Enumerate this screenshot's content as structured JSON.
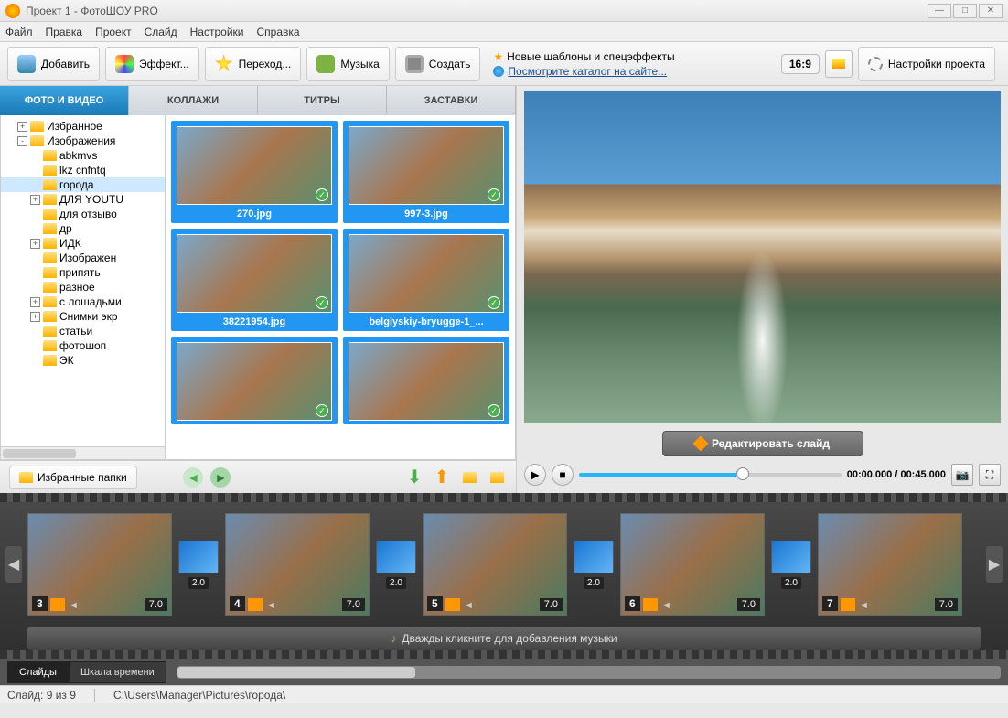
{
  "window": {
    "title": "Проект 1 - ФотоШОУ PRO"
  },
  "menu": [
    "Файл",
    "Правка",
    "Проект",
    "Слайд",
    "Настройки",
    "Справка"
  ],
  "toolbar": {
    "add": "Добавить",
    "fx": "Эффект...",
    "trans": "Переход...",
    "music": "Музыка",
    "create": "Создать",
    "info1": "Новые шаблоны и спецэффекты",
    "info2": "Посмотрите каталог на сайте...",
    "aspect": "16:9",
    "settings": "Настройки проекта"
  },
  "tabs": [
    "ФОТО И ВИДЕО",
    "КОЛЛАЖИ",
    "ТИТРЫ",
    "ЗАСТАВКИ"
  ],
  "tree": [
    {
      "exp": "+",
      "ind": 1,
      "label": "Избранное"
    },
    {
      "exp": "-",
      "ind": 1,
      "label": "Изображения"
    },
    {
      "exp": "",
      "ind": 2,
      "label": "abkmvs"
    },
    {
      "exp": "",
      "ind": 2,
      "label": "lkz cnfntq"
    },
    {
      "exp": "",
      "ind": 2,
      "label": "города",
      "sel": true
    },
    {
      "exp": "+",
      "ind": 2,
      "label": "ДЛЯ YOUTU"
    },
    {
      "exp": "",
      "ind": 2,
      "label": "для отзыво"
    },
    {
      "exp": "",
      "ind": 2,
      "label": "др"
    },
    {
      "exp": "+",
      "ind": 2,
      "label": "ИДК"
    },
    {
      "exp": "",
      "ind": 2,
      "label": "Изображен"
    },
    {
      "exp": "",
      "ind": 2,
      "label": "припять"
    },
    {
      "exp": "",
      "ind": 2,
      "label": "разное"
    },
    {
      "exp": "+",
      "ind": 2,
      "label": "с лошадьми"
    },
    {
      "exp": "+",
      "ind": 2,
      "label": "Снимки экр"
    },
    {
      "exp": "",
      "ind": 2,
      "label": "статьи"
    },
    {
      "exp": "",
      "ind": 2,
      "label": "фотошоп"
    },
    {
      "exp": "",
      "ind": 2,
      "label": "ЭК"
    }
  ],
  "thumbs": [
    "270.jpg",
    "997-3.jpg",
    "38221954.jpg",
    "belgiyskiy-bryugge-1_...",
    "",
    ""
  ],
  "browserbar": {
    "fav": "Избранные папки"
  },
  "preview": {
    "edit": "Редактировать слайд",
    "time": "00:00.000 / 00:45.000"
  },
  "timeline": {
    "slides": [
      {
        "n": "3",
        "d": "7.0"
      },
      {
        "n": "4",
        "d": "7.0"
      },
      {
        "n": "5",
        "d": "7.0"
      },
      {
        "n": "6",
        "d": "7.0"
      },
      {
        "n": "7",
        "d": "7.0"
      }
    ],
    "transdur": "2.0",
    "audio": "Дважды кликните для добавления музыки",
    "tab1": "Слайды",
    "tab2": "Шкала времени"
  },
  "status": {
    "left": "Слайд: 9 из 9",
    "path": "C:\\Users\\Manager\\Pictures\\города\\"
  }
}
